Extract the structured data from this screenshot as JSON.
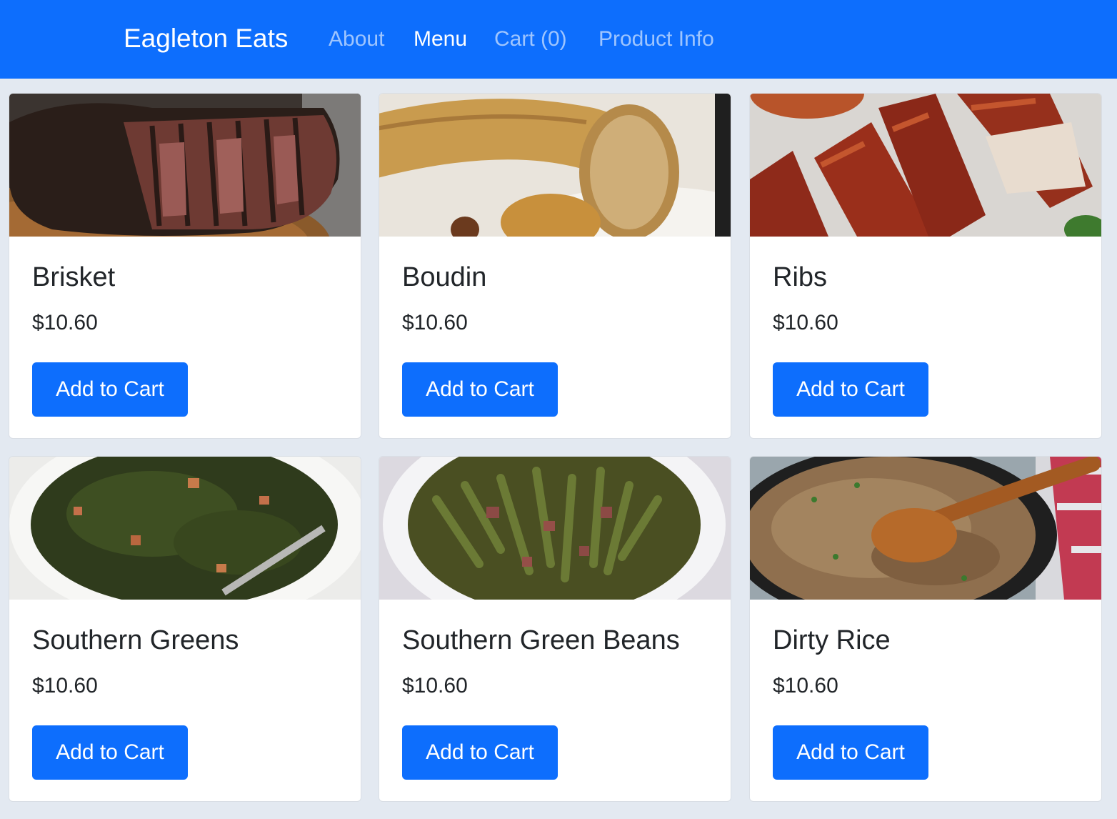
{
  "navbar": {
    "brand": "Eagleton Eats",
    "links": [
      {
        "label": "About"
      },
      {
        "label": "Menu"
      },
      {
        "label": "Cart (0)"
      },
      {
        "label": "Product Info"
      }
    ]
  },
  "colors": {
    "primary": "#0d6efd",
    "page_background": "#e3e9f1"
  },
  "menu": {
    "items": [
      {
        "name": "Brisket",
        "price": "$10.60",
        "button": "Add to Cart",
        "image": "brisket-photo"
      },
      {
        "name": "Boudin",
        "price": "$10.60",
        "button": "Add to Cart",
        "image": "boudin-photo"
      },
      {
        "name": "Ribs",
        "price": "$10.60",
        "button": "Add to Cart",
        "image": "ribs-photo"
      },
      {
        "name": "Southern Greens",
        "price": "$10.60",
        "button": "Add to Cart",
        "image": "greens-photo"
      },
      {
        "name": "Southern Green Beans",
        "price": "$10.60",
        "button": "Add to Cart",
        "image": "green-beans-photo"
      },
      {
        "name": "Dirty Rice",
        "price": "$10.60",
        "button": "Add to Cart",
        "image": "dirty-rice-photo"
      }
    ]
  }
}
